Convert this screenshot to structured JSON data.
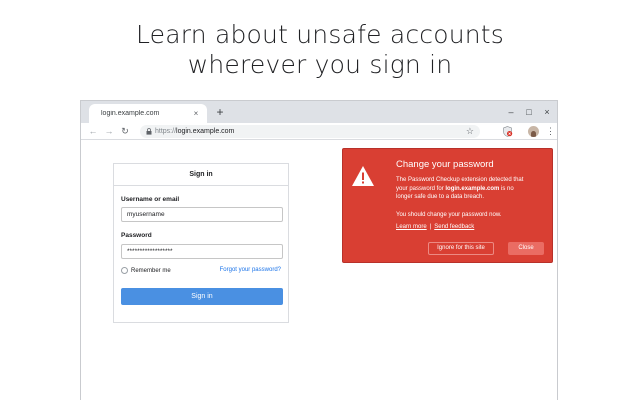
{
  "headline": {
    "line1": "Learn about unsafe accounts",
    "line2": "wherever you sign in"
  },
  "browser": {
    "tab": {
      "title": "login.example.com",
      "close_glyph": "×"
    },
    "new_tab_glyph": "+",
    "window_controls": {
      "minimize": "–",
      "maximize": "□",
      "close": "×"
    },
    "nav": {
      "back": "←",
      "forward": "→",
      "reload": "↻"
    },
    "omnibox": {
      "scheme": "https://",
      "host": "login.example.com",
      "lock_icon": "lock-icon",
      "star_glyph": "☆"
    },
    "menu_glyph": "⋮"
  },
  "signin_form": {
    "title": "Sign in",
    "username_label": "Username or email",
    "username_value": "myusername",
    "password_label": "Password",
    "password_value": "******************",
    "remember_label": "Remember me",
    "forgot_link": "Forgot your password?",
    "submit_label": "Sign in"
  },
  "alert": {
    "title": "Change your password",
    "body_line1": "The Password Checkup extension detected that",
    "body_line2_pre": "your password for ",
    "body_line2_bold": "login.example.com",
    "body_line2_post": " is no",
    "body_line3": "longer safe due to a data breach.",
    "note": "You should change your password now.",
    "learn_more": "Learn more",
    "separator": "|",
    "send_feedback": "Send feedback",
    "ignore_label": "Ignore for this site",
    "close_label": "Close"
  },
  "colors": {
    "alert_red": "#d93f33",
    "signin_blue": "#4a90e2",
    "link_blue": "#1a73e8",
    "tabstrip_gray": "#dee1e6"
  }
}
